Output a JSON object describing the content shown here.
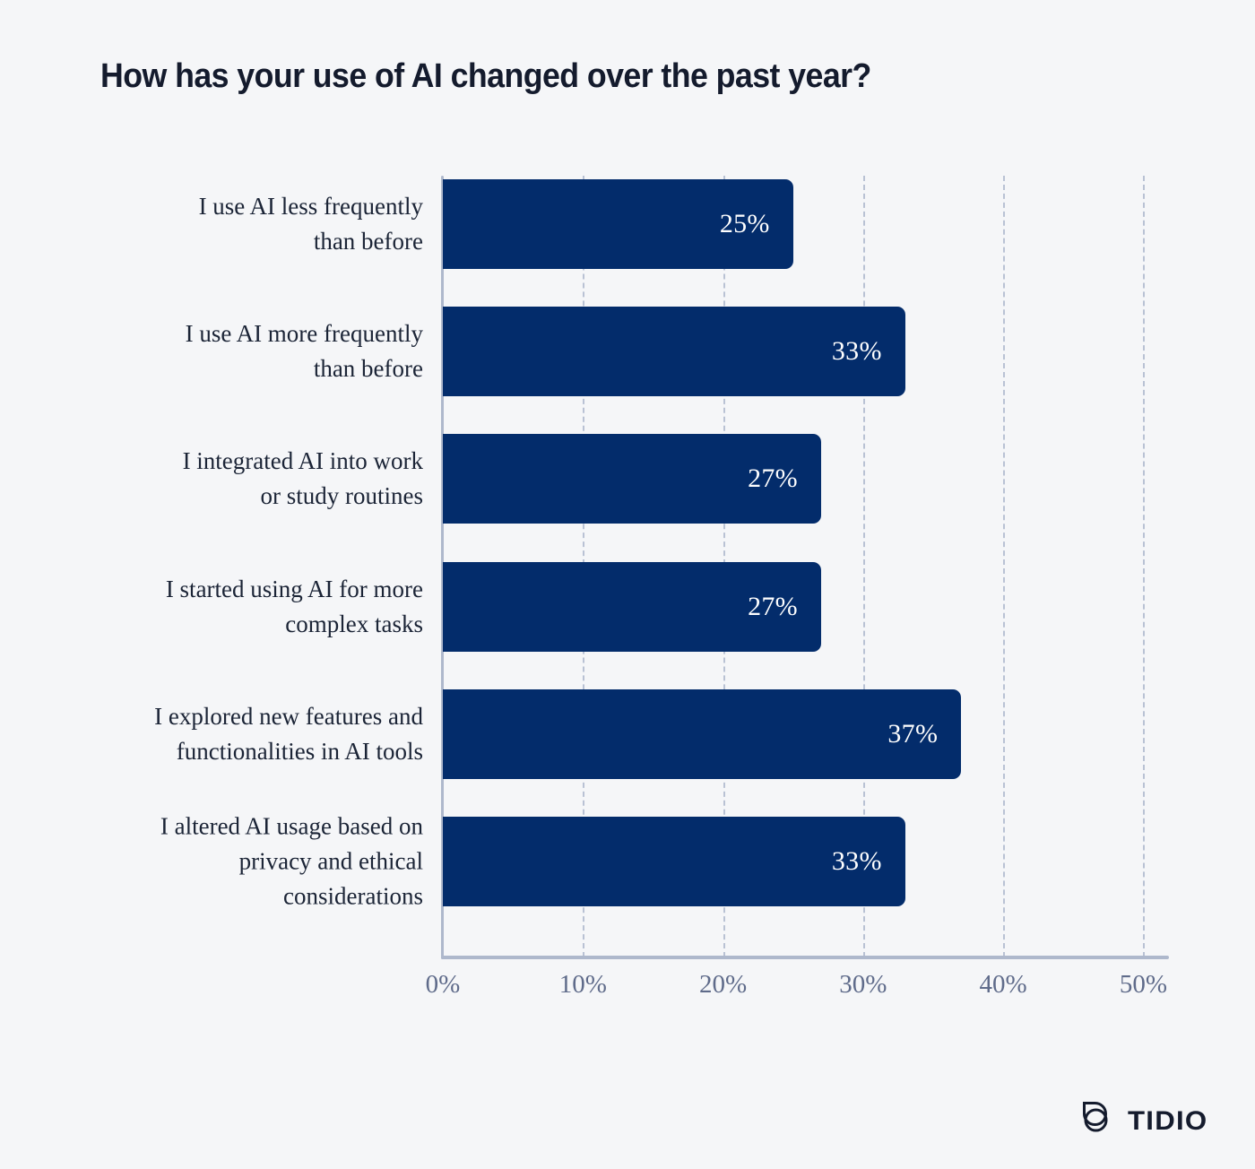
{
  "title": "How has your use of AI changed over the past year?",
  "colors": {
    "background": "#f5f6f8",
    "bar": "#032c6b",
    "title_text": "#141b2d",
    "category_text": "#1b2436",
    "value_text": "#ffffff",
    "tick_text": "#5f6b8a",
    "axis_line": "#aeb8cc",
    "gridline": "#b9c2d4",
    "logo": "#141b2d"
  },
  "logo": {
    "wordmark": "TIDIO",
    "mark_name": "tidio-speech-bubble-logo"
  },
  "chart_data": {
    "type": "bar",
    "orientation": "horizontal",
    "title": "How has your use of AI changed over the past year?",
    "xlabel": "",
    "ylabel": "",
    "xlim": [
      0,
      51.7
    ],
    "xticks": [
      0,
      10,
      20,
      30,
      40,
      50
    ],
    "xtick_labels": [
      "0%",
      "10%",
      "20%",
      "30%",
      "40%",
      "50%"
    ],
    "grid": "vertical-dashed",
    "legend": "none",
    "value_suffix": "%",
    "categories": [
      "I use AI less frequently than before",
      "I use AI more frequently than before",
      "I integrated AI into work or study routines",
      "I started using AI for more complex tasks",
      "I explored new features and functionalities in AI tools",
      "I altered AI usage based on privacy and ethical considerations"
    ],
    "values": [
      25,
      33,
      27,
      27,
      37,
      33
    ],
    "value_labels": [
      "25%",
      "33%",
      "27%",
      "27%",
      "37%",
      "33%"
    ],
    "category_lines": [
      [
        "I use AI less frequently",
        "than before"
      ],
      [
        "I use AI more frequently",
        "than before"
      ],
      [
        "I integrated AI into work",
        "or study routines"
      ],
      [
        "I started using AI for more",
        "complex tasks"
      ],
      [
        "I explored new features and",
        "functionalities in AI tools"
      ],
      [
        "I altered AI usage based on",
        "privacy and ethical",
        "considerations"
      ]
    ]
  }
}
